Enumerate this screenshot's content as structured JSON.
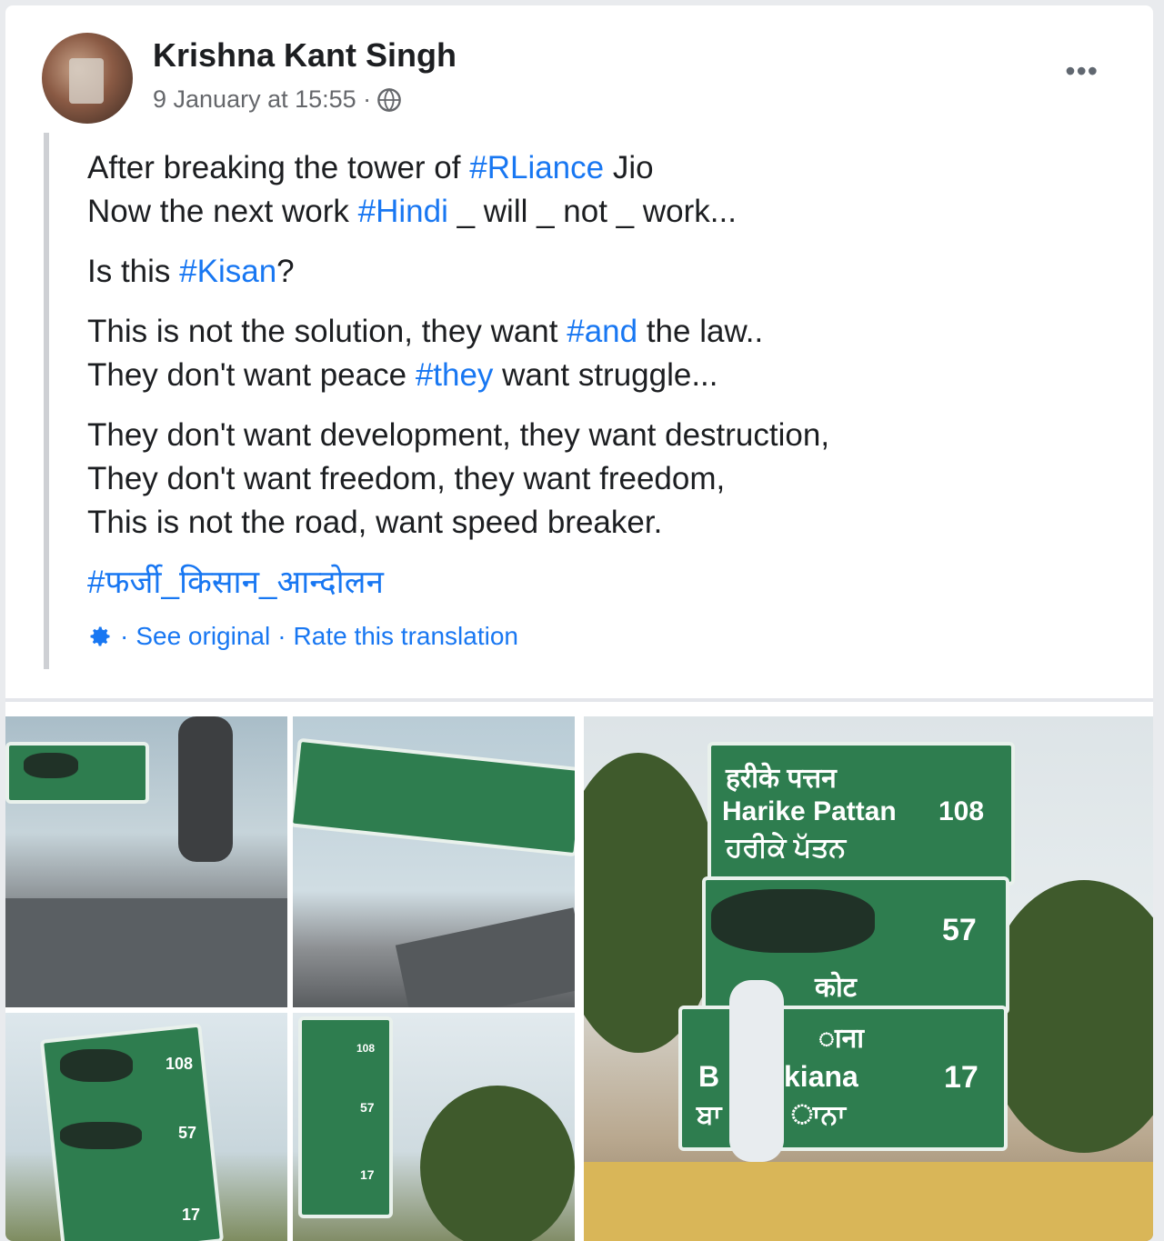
{
  "post": {
    "author": "Krishna Kant Singh",
    "timestamp": "9 January at 15:55 ·",
    "privacy_icon": "globe-icon",
    "more_icon": "•••",
    "paragraphs": [
      [
        {
          "t": "After breaking the tower of "
        },
        {
          "t": "#RLiance",
          "tag": true
        },
        {
          "t": " Jio"
        },
        {
          "br": true
        },
        {
          "t": "Now the next work "
        },
        {
          "t": "#Hindi",
          "tag": true
        },
        {
          "t": " _ will _ not _ work..."
        }
      ],
      [
        {
          "t": "Is this "
        },
        {
          "t": "#Kisan",
          "tag": true
        },
        {
          "t": "?"
        }
      ],
      [
        {
          "t": "This is not the solution, they want "
        },
        {
          "t": "#and",
          "tag": true
        },
        {
          "t": " the law.."
        },
        {
          "br": true
        },
        {
          "t": "They don't want peace "
        },
        {
          "t": "#they",
          "tag": true
        },
        {
          "t": " want struggle..."
        }
      ],
      [
        {
          "t": "They don't want development, they want destruction,"
        },
        {
          "br": true
        },
        {
          "t": "They don't want freedom, they want freedom,"
        },
        {
          "br": true
        },
        {
          "t": "This is not the road, want speed breaker."
        }
      ],
      [
        {
          "t": "#फर्जी_किसान_आन्दोलन",
          "tag": true
        }
      ]
    ],
    "translation": {
      "gear_icon": "gear-icon",
      "sep1": "·",
      "see_original": "See original",
      "sep2": "·",
      "rate": "Rate this translation"
    }
  },
  "photos": {
    "sign_main": {
      "hindi": "हरीके पत्तन",
      "english": "Harike Pattan",
      "distance1": "108",
      "punjabi": "ਹਰੀਕੇ ਪੱਤਨ",
      "distance2": "57",
      "partial1": "कोट",
      "partial2": "ाना",
      "partial3": "B",
      "partial4": "kiana",
      "distance3": "17",
      "partial5": "ਬਾ",
      "partial6": "ਾਨਾ"
    },
    "sign_small": {
      "distance1": "108",
      "distance2": "57",
      "distance3": "17"
    }
  }
}
